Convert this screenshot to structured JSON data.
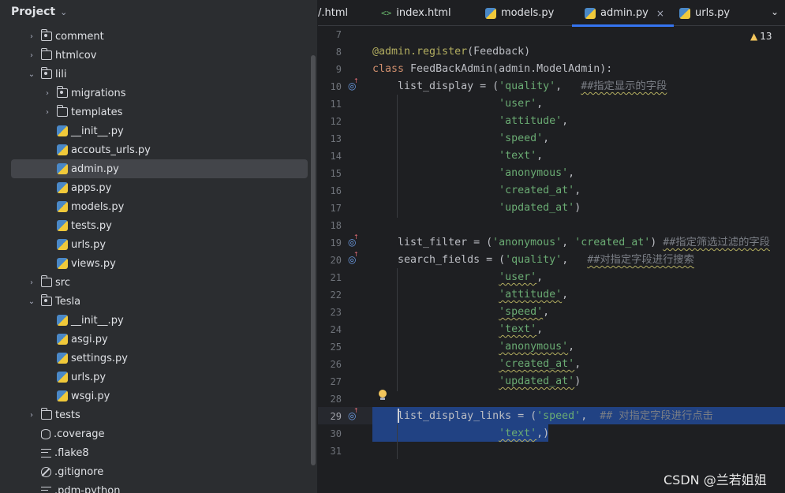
{
  "project": {
    "title": "Project",
    "tree": [
      {
        "label": "comment",
        "icon": "package-folder-icon",
        "arrow": "›",
        "indent": 1
      },
      {
        "label": "htmlcov",
        "icon": "folder-icon",
        "arrow": "›",
        "indent": 1
      },
      {
        "label": "lili",
        "icon": "package-folder-icon",
        "arrow": "⌄",
        "indent": 1
      },
      {
        "label": "migrations",
        "icon": "package-folder-icon",
        "arrow": "›",
        "indent": 2
      },
      {
        "label": "templates",
        "icon": "folder-icon",
        "arrow": "›",
        "indent": 2
      },
      {
        "label": "__init__.py",
        "icon": "python-file-icon",
        "arrow": "",
        "indent": 2
      },
      {
        "label": "accouts_urls.py",
        "icon": "python-file-icon",
        "arrow": "",
        "indent": 2
      },
      {
        "label": "admin.py",
        "icon": "python-file-icon",
        "arrow": "",
        "indent": 2,
        "selected": true
      },
      {
        "label": "apps.py",
        "icon": "python-file-icon",
        "arrow": "",
        "indent": 2
      },
      {
        "label": "models.py",
        "icon": "python-file-icon",
        "arrow": "",
        "indent": 2
      },
      {
        "label": "tests.py",
        "icon": "python-file-icon",
        "arrow": "",
        "indent": 2
      },
      {
        "label": "urls.py",
        "icon": "python-file-icon",
        "arrow": "",
        "indent": 2
      },
      {
        "label": "views.py",
        "icon": "python-file-icon",
        "arrow": "",
        "indent": 2
      },
      {
        "label": "src",
        "icon": "folder-icon",
        "arrow": "›",
        "indent": 1
      },
      {
        "label": "Tesla",
        "icon": "package-folder-icon",
        "arrow": "⌄",
        "indent": 1
      },
      {
        "label": "__init__.py",
        "icon": "python-file-icon",
        "arrow": "",
        "indent": 2
      },
      {
        "label": "asgi.py",
        "icon": "python-file-icon",
        "arrow": "",
        "indent": 2
      },
      {
        "label": "settings.py",
        "icon": "python-file-icon",
        "arrow": "",
        "indent": 2
      },
      {
        "label": "urls.py",
        "icon": "python-file-icon",
        "arrow": "",
        "indent": 2
      },
      {
        "label": "wsgi.py",
        "icon": "python-file-icon",
        "arrow": "",
        "indent": 2
      },
      {
        "label": "tests",
        "icon": "folder-icon",
        "arrow": "›",
        "indent": 1
      },
      {
        "label": ".coverage",
        "icon": "database-icon",
        "arrow": "",
        "indent": 1
      },
      {
        "label": ".flake8",
        "icon": "text-file-icon",
        "arrow": "",
        "indent": 1
      },
      {
        "label": ".gitignore",
        "icon": "ignore-file-icon",
        "arrow": "",
        "indent": 1
      },
      {
        "label": ".pdm-python",
        "icon": "text-file-icon",
        "arrow": "",
        "indent": 1
      }
    ]
  },
  "tabs": [
    {
      "label": "/.html",
      "icon": "none",
      "active": false
    },
    {
      "label": "index.html",
      "icon": "html-file-icon",
      "active": false
    },
    {
      "label": "models.py",
      "icon": "python-file-icon",
      "active": false
    },
    {
      "label": "admin.py",
      "icon": "python-file-icon",
      "active": true,
      "close": "×"
    },
    {
      "label": "urls.py",
      "icon": "python-file-icon",
      "active": false
    }
  ],
  "editor": {
    "warning_count": "13",
    "line_numbers": [
      "7",
      "8",
      "9",
      "10",
      "11",
      "12",
      "13",
      "14",
      "15",
      "16",
      "17",
      "18",
      "19",
      "20",
      "21",
      "22",
      "23",
      "24",
      "25",
      "26",
      "27",
      "28",
      "29",
      "30",
      "31"
    ],
    "lines": [
      [],
      [
        {
          "t": "@admin.register",
          "c": "dec"
        },
        {
          "t": "(Feedback)",
          "c": ""
        }
      ],
      [
        {
          "t": "class ",
          "c": "kw"
        },
        {
          "t": "FeedBackAdmin(admin.ModelAdmin):",
          "c": ""
        }
      ],
      [
        {
          "t": "    list_display = (",
          "c": ""
        },
        {
          "t": "'quality'",
          "c": "str"
        },
        {
          "t": ",   ",
          "c": ""
        },
        {
          "t": "##指定显示的字段",
          "c": "cmt wavy"
        }
      ],
      [
        {
          "t": "                    ",
          "c": ""
        },
        {
          "t": "'user'",
          "c": "str"
        },
        {
          "t": ",",
          "c": ""
        }
      ],
      [
        {
          "t": "                    ",
          "c": ""
        },
        {
          "t": "'attitude'",
          "c": "str"
        },
        {
          "t": ",",
          "c": ""
        }
      ],
      [
        {
          "t": "                    ",
          "c": ""
        },
        {
          "t": "'speed'",
          "c": "str"
        },
        {
          "t": ",",
          "c": ""
        }
      ],
      [
        {
          "t": "                    ",
          "c": ""
        },
        {
          "t": "'text'",
          "c": "str"
        },
        {
          "t": ",",
          "c": ""
        }
      ],
      [
        {
          "t": "                    ",
          "c": ""
        },
        {
          "t": "'anonymous'",
          "c": "str"
        },
        {
          "t": ",",
          "c": ""
        }
      ],
      [
        {
          "t": "                    ",
          "c": ""
        },
        {
          "t": "'created_at'",
          "c": "str"
        },
        {
          "t": ",",
          "c": ""
        }
      ],
      [
        {
          "t": "                    ",
          "c": ""
        },
        {
          "t": "'updated_at'",
          "c": "str"
        },
        {
          "t": ")",
          "c": ""
        }
      ],
      [],
      [
        {
          "t": "    list_filter = (",
          "c": ""
        },
        {
          "t": "'anonymous'",
          "c": "str"
        },
        {
          "t": ", ",
          "c": ""
        },
        {
          "t": "'created_at'",
          "c": "str"
        },
        {
          "t": ") ",
          "c": ""
        },
        {
          "t": "##指定筛选过滤的字段",
          "c": "cmt wavy"
        }
      ],
      [
        {
          "t": "    search_fields = (",
          "c": ""
        },
        {
          "t": "'quality'",
          "c": "str"
        },
        {
          "t": ",   ",
          "c": ""
        },
        {
          "t": "##对指定字段进行搜索",
          "c": "cmt wavy"
        }
      ],
      [
        {
          "t": "                    ",
          "c": ""
        },
        {
          "t": "'user'",
          "c": "str wavy"
        },
        {
          "t": ",",
          "c": ""
        }
      ],
      [
        {
          "t": "                    ",
          "c": ""
        },
        {
          "t": "'attitude'",
          "c": "str wavy"
        },
        {
          "t": ",",
          "c": ""
        }
      ],
      [
        {
          "t": "                    ",
          "c": ""
        },
        {
          "t": "'speed'",
          "c": "str wavy"
        },
        {
          "t": ",",
          "c": ""
        }
      ],
      [
        {
          "t": "                    ",
          "c": ""
        },
        {
          "t": "'text'",
          "c": "str wavy"
        },
        {
          "t": ",",
          "c": ""
        }
      ],
      [
        {
          "t": "                    ",
          "c": ""
        },
        {
          "t": "'anonymous'",
          "c": "str wavy"
        },
        {
          "t": ",",
          "c": ""
        }
      ],
      [
        {
          "t": "                    ",
          "c": ""
        },
        {
          "t": "'created_at'",
          "c": "str wavy"
        },
        {
          "t": ",",
          "c": ""
        }
      ],
      [
        {
          "t": "                    ",
          "c": ""
        },
        {
          "t": "'updated_at'",
          "c": "str wavy"
        },
        {
          "t": ")",
          "c": ""
        }
      ],
      [],
      [
        {
          "t": "    list_display_links = (",
          "c": ""
        },
        {
          "t": "'speed'",
          "c": "str"
        },
        {
          "t": ",  ",
          "c": ""
        },
        {
          "t": "## 对指定字段进行点击",
          "c": "cmt"
        }
      ],
      [
        {
          "t": "                    ",
          "c": ""
        },
        {
          "t": "'text'",
          "c": "str wavy"
        },
        {
          "t": ",)",
          "c": ""
        }
      ],
      []
    ]
  },
  "watermark": "CSDN @兰若姐姐",
  "colors": {
    "accent": "#3574f0",
    "selection": "#214283",
    "string": "#6aab73",
    "keyword": "#cf8e6d"
  }
}
